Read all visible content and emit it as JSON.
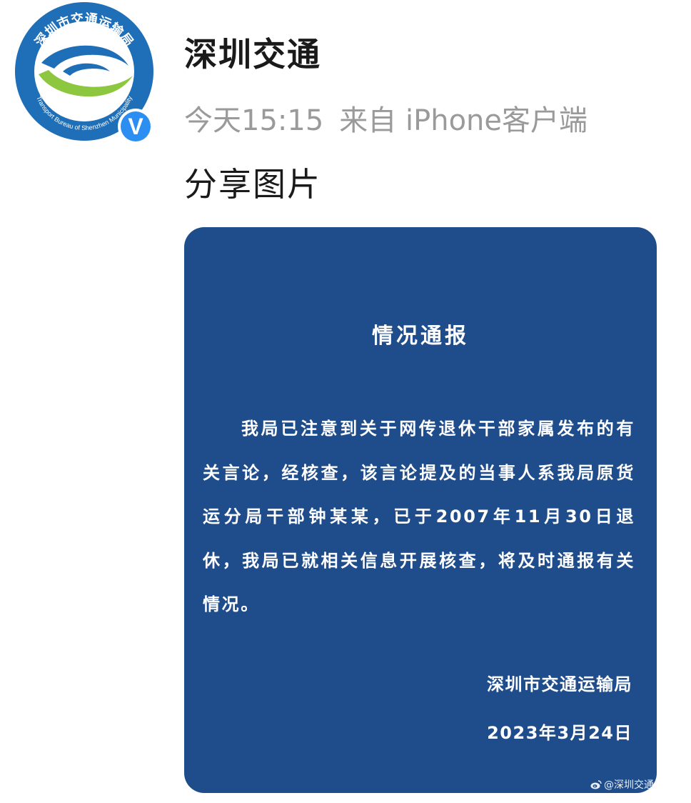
{
  "post": {
    "account_name": "深圳交通",
    "time": "今天15:15",
    "source": "来自 iPhone客户端",
    "text": "分享图片",
    "avatar_logo_text_cn": "深圳市交通运输局",
    "avatar_logo_text_en": "Transport Bureau of Shenzhen Municipality",
    "verified_badge": "V"
  },
  "notice": {
    "title": "情况通报",
    "body": "我局已注意到关于网传退休干部家属发布的有关言论，经核查，该言论提及的当事人系我局原货运分局干部钟某某，已于2007年11月30日退休，我局已就相关信息开展核查，将及时通报有关情况。",
    "issuer": "深圳市交通运输局",
    "date": "2023年3月24日",
    "watermark": "@深圳交通"
  },
  "colors": {
    "notice_background": "#1f4d8c",
    "logo_blue": "#1e6fb8",
    "logo_green": "#8dc63f",
    "verified_blue": "#2b8ef0",
    "meta_gray": "#9a9a9a"
  },
  "icons": {
    "verified": "verified-v-icon",
    "watermark": "weibo-logo-icon"
  }
}
